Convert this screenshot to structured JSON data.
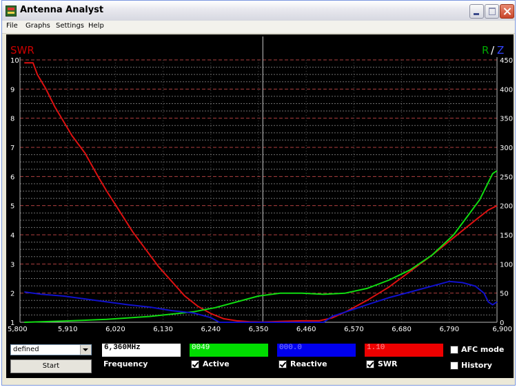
{
  "window": {
    "title": "Antenna Analyst"
  },
  "menu": [
    "File",
    "Graphs",
    "Settings",
    "Help"
  ],
  "chart_data": {
    "type": "line",
    "title": "",
    "left_axis_label": "SWR",
    "right_axis_label_r": "R",
    "right_axis_separator": "/",
    "right_axis_label_z": "Z",
    "left_ticks": [
      "10",
      "9",
      "8",
      "7",
      "6",
      "5",
      "4",
      "3",
      "2",
      "1"
    ],
    "right_ticks": [
      "450",
      "400",
      "350",
      "300",
      "250",
      "200",
      "150",
      "100",
      "50",
      "0"
    ],
    "x_ticks": [
      "5,800",
      "5,910",
      "6,020",
      "6,130",
      "6,240",
      "6,350",
      "6,460",
      "6,570",
      "6,680",
      "6,790",
      "6,900"
    ],
    "xlim": [
      5800,
      6900
    ],
    "ylim_left": [
      1,
      10
    ],
    "ylim_right": [
      0,
      450
    ],
    "cursor_x": 6360,
    "grid": true,
    "colors": {
      "swr": "#dd1111",
      "r": "#11dd11",
      "z": "#1111cc",
      "grid": "#ffffff",
      "axis_left": "#cc0000",
      "axis_right": "#00aa00"
    },
    "series": [
      {
        "name": "SWR",
        "axis": "left",
        "color": "#dd1111",
        "x": [
          5810,
          5830,
          5840,
          5860,
          5880,
          5900,
          5920,
          5950,
          5980,
          6000,
          6030,
          6060,
          6090,
          6120,
          6150,
          6180,
          6210,
          6240,
          6270,
          6300,
          6330,
          6360,
          6400,
          6450,
          6490,
          6520,
          6550,
          6600,
          6650,
          6700,
          6750,
          6800,
          6850,
          6880,
          6900
        ],
        "y": [
          9.9,
          9.9,
          9.5,
          9.0,
          8.4,
          7.9,
          7.4,
          6.8,
          6.0,
          5.5,
          4.8,
          4.1,
          3.5,
          2.9,
          2.4,
          1.9,
          1.55,
          1.3,
          1.12,
          1.05,
          1.02,
          1.01,
          1.03,
          1.05,
          1.05,
          1.15,
          1.35,
          1.75,
          2.2,
          2.75,
          3.3,
          3.9,
          4.5,
          4.85,
          5.0
        ]
      },
      {
        "name": "R",
        "axis": "right",
        "color": "#11dd11",
        "x": [
          5810,
          5900,
          6000,
          6100,
          6200,
          6250,
          6300,
          6350,
          6400,
          6450,
          6500,
          6550,
          6600,
          6650,
          6700,
          6750,
          6800,
          6830,
          6860,
          6880,
          6890,
          6900
        ],
        "y": [
          0,
          2,
          5,
          10,
          18,
          25,
          35,
          45,
          50,
          50,
          48,
          50,
          58,
          72,
          90,
          115,
          150,
          180,
          210,
          240,
          255,
          260
        ]
      },
      {
        "name": "Z",
        "axis": "right",
        "color": "#1111cc",
        "x": [
          5810,
          5850,
          5900,
          5950,
          6000,
          6050,
          6100,
          6150,
          6200,
          6240,
          6260,
          6300,
          6350,
          6400,
          6450,
          6500,
          6520,
          6560,
          6600,
          6650,
          6700,
          6750,
          6790,
          6820,
          6850,
          6870,
          6880,
          6890,
          6900
        ],
        "y": [
          52,
          48,
          45,
          40,
          35,
          30,
          26,
          20,
          16,
          8,
          0,
          0,
          0,
          0,
          0,
          0,
          10,
          20,
          30,
          42,
          52,
          62,
          70,
          68,
          62,
          50,
          35,
          30,
          35
        ]
      }
    ]
  },
  "controls": {
    "mode_select": "defined",
    "start_label": "Start",
    "frequency_value": "6,360MHz",
    "frequency_label": "Frequency",
    "active_value": "0049",
    "active_label": "Active",
    "reactive_value": "000.0",
    "reactive_label": "Reactive",
    "swr_value": "1.10",
    "swr_label": "SWR",
    "afc_label": "AFC mode",
    "history_label": "History",
    "colors": {
      "frequency": "#ffffff",
      "active": "#00dd00",
      "reactive": "#0000ee",
      "swr": "#ee0000"
    }
  }
}
